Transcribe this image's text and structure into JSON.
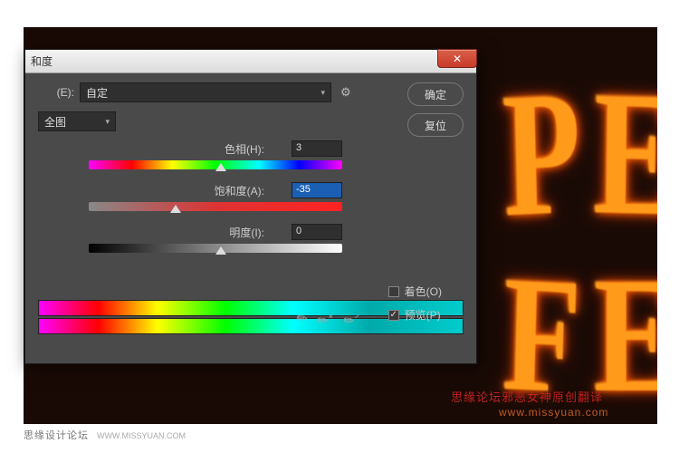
{
  "dialog": {
    "title": "和度",
    "preset_label": "(E):",
    "preset_value": "自定",
    "channel_value": "全图",
    "ok_label": "确定",
    "reset_label": "复位",
    "hue": {
      "label": "色相(H):",
      "value": "3",
      "thumb_pct": 50
    },
    "saturation": {
      "label": "饱和度(A):",
      "value": "-35",
      "thumb_pct": 32
    },
    "lightness": {
      "label": "明度(I):",
      "value": "0",
      "thumb_pct": 50
    },
    "colorize_label": "着色(O)",
    "colorize_checked": false,
    "preview_label": "预览(P)",
    "preview_checked": true
  },
  "background": {
    "credit1": "思缘论坛邪恶女神原创翻译",
    "credit2": "www.missyuan.com"
  },
  "footer": {
    "brand": "思缘设计论坛",
    "url": "WWW.MISSYUAN.COM"
  }
}
